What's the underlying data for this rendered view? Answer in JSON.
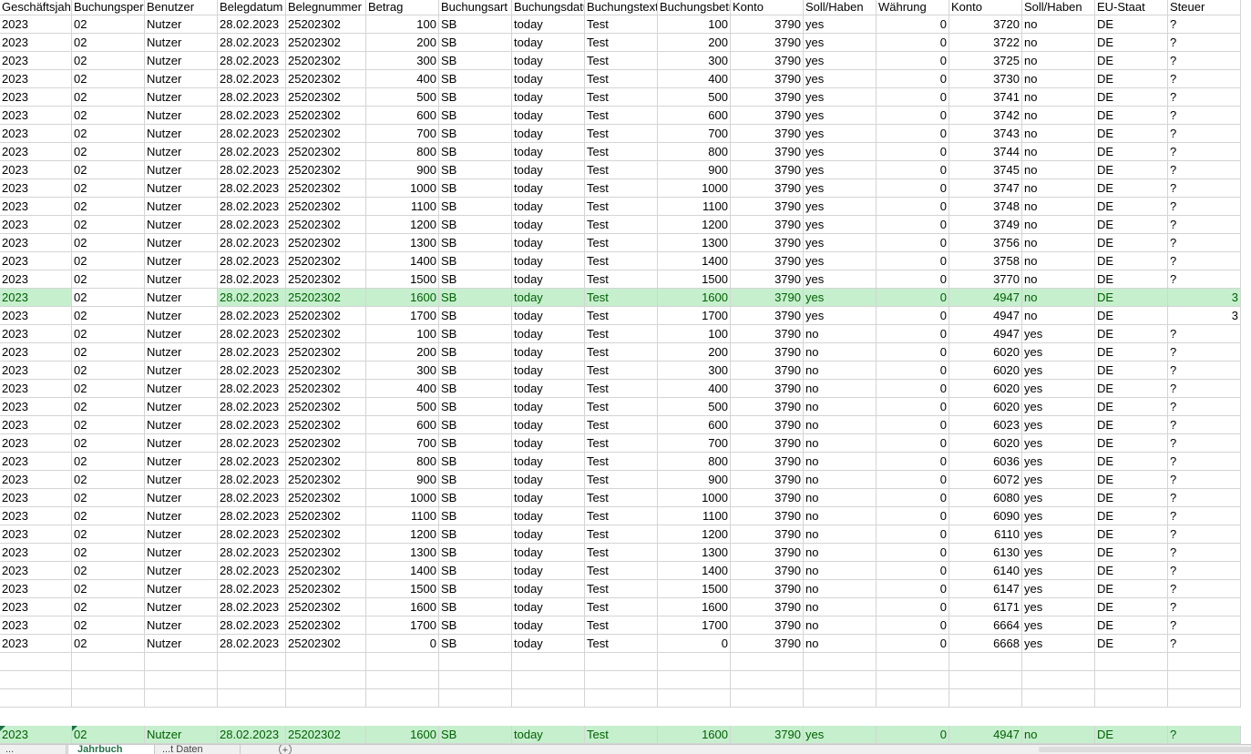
{
  "header": [
    "Geschäftsjahr",
    "Buchungsperiode",
    "Benutzer",
    "Belegdatum",
    "Belegnummer",
    "Betrag",
    "Buchungsart",
    "Buchungsdatum",
    "Buchungstext",
    "Buchungsbetrag",
    "Konto",
    "Soll/Haben",
    "Währung",
    "Konto",
    "Soll/Haben",
    "EU-Staat",
    "Steuer"
  ],
  "rows": [
    [
      "2023",
      "02",
      "Nutzer",
      "28.02.2023",
      "25202302",
      "100",
      "SB",
      "today",
      "Test",
      "100",
      "3790",
      "yes",
      "0",
      "3720",
      "no",
      "DE",
      "?"
    ],
    [
      "2023",
      "02",
      "Nutzer",
      "28.02.2023",
      "25202302",
      "200",
      "SB",
      "today",
      "Test",
      "200",
      "3790",
      "yes",
      "0",
      "3722",
      "no",
      "DE",
      "?"
    ],
    [
      "2023",
      "02",
      "Nutzer",
      "28.02.2023",
      "25202302",
      "300",
      "SB",
      "today",
      "Test",
      "300",
      "3790",
      "yes",
      "0",
      "3725",
      "no",
      "DE",
      "?"
    ],
    [
      "2023",
      "02",
      "Nutzer",
      "28.02.2023",
      "25202302",
      "400",
      "SB",
      "today",
      "Test",
      "400",
      "3790",
      "yes",
      "0",
      "3730",
      "no",
      "DE",
      "?"
    ],
    [
      "2023",
      "02",
      "Nutzer",
      "28.02.2023",
      "25202302",
      "500",
      "SB",
      "today",
      "Test",
      "500",
      "3790",
      "yes",
      "0",
      "3741",
      "no",
      "DE",
      "?"
    ],
    [
      "2023",
      "02",
      "Nutzer",
      "28.02.2023",
      "25202302",
      "600",
      "SB",
      "today",
      "Test",
      "600",
      "3790",
      "yes",
      "0",
      "3742",
      "no",
      "DE",
      "?"
    ],
    [
      "2023",
      "02",
      "Nutzer",
      "28.02.2023",
      "25202302",
      "700",
      "SB",
      "today",
      "Test",
      "700",
      "3790",
      "yes",
      "0",
      "3743",
      "no",
      "DE",
      "?"
    ],
    [
      "2023",
      "02",
      "Nutzer",
      "28.02.2023",
      "25202302",
      "800",
      "SB",
      "today",
      "Test",
      "800",
      "3790",
      "yes",
      "0",
      "3744",
      "no",
      "DE",
      "?"
    ],
    [
      "2023",
      "02",
      "Nutzer",
      "28.02.2023",
      "25202302",
      "900",
      "SB",
      "today",
      "Test",
      "900",
      "3790",
      "yes",
      "0",
      "3745",
      "no",
      "DE",
      "?"
    ],
    [
      "2023",
      "02",
      "Nutzer",
      "28.02.2023",
      "25202302",
      "1000",
      "SB",
      "today",
      "Test",
      "1000",
      "3790",
      "yes",
      "0",
      "3747",
      "no",
      "DE",
      "?"
    ],
    [
      "2023",
      "02",
      "Nutzer",
      "28.02.2023",
      "25202302",
      "1100",
      "SB",
      "today",
      "Test",
      "1100",
      "3790",
      "yes",
      "0",
      "3748",
      "no",
      "DE",
      "?"
    ],
    [
      "2023",
      "02",
      "Nutzer",
      "28.02.2023",
      "25202302",
      "1200",
      "SB",
      "today",
      "Test",
      "1200",
      "3790",
      "yes",
      "0",
      "3749",
      "no",
      "DE",
      "?"
    ],
    [
      "2023",
      "02",
      "Nutzer",
      "28.02.2023",
      "25202302",
      "1300",
      "SB",
      "today",
      "Test",
      "1300",
      "3790",
      "yes",
      "0",
      "3756",
      "no",
      "DE",
      "?"
    ],
    [
      "2023",
      "02",
      "Nutzer",
      "28.02.2023",
      "25202302",
      "1400",
      "SB",
      "today",
      "Test",
      "1400",
      "3790",
      "yes",
      "0",
      "3758",
      "no",
      "DE",
      "?"
    ],
    [
      "2023",
      "02",
      "Nutzer",
      "28.02.2023",
      "25202302",
      "1500",
      "SB",
      "today",
      "Test",
      "1500",
      "3790",
      "yes",
      "0",
      "3770",
      "no",
      "DE",
      "?"
    ],
    [
      "2023",
      "02",
      "Nutzer",
      "28.02.2023",
      "25202302",
      "1600",
      "SB",
      "today",
      "Test",
      "1600",
      "3790",
      "yes",
      "0",
      "4947",
      "no",
      "DE",
      "3"
    ],
    [
      "2023",
      "02",
      "Nutzer",
      "28.02.2023",
      "25202302",
      "1700",
      "SB",
      "today",
      "Test",
      "1700",
      "3790",
      "yes",
      "0",
      "4947",
      "no",
      "DE",
      "3"
    ],
    [
      "2023",
      "02",
      "Nutzer",
      "28.02.2023",
      "25202302",
      "100",
      "SB",
      "today",
      "Test",
      "100",
      "3790",
      "no",
      "0",
      "4947",
      "yes",
      "DE",
      "?"
    ],
    [
      "2023",
      "02",
      "Nutzer",
      "28.02.2023",
      "25202302",
      "200",
      "SB",
      "today",
      "Test",
      "200",
      "3790",
      "no",
      "0",
      "6020",
      "yes",
      "DE",
      "?"
    ],
    [
      "2023",
      "02",
      "Nutzer",
      "28.02.2023",
      "25202302",
      "300",
      "SB",
      "today",
      "Test",
      "300",
      "3790",
      "no",
      "0",
      "6020",
      "yes",
      "DE",
      "?"
    ],
    [
      "2023",
      "02",
      "Nutzer",
      "28.02.2023",
      "25202302",
      "400",
      "SB",
      "today",
      "Test",
      "400",
      "3790",
      "no",
      "0",
      "6020",
      "yes",
      "DE",
      "?"
    ],
    [
      "2023",
      "02",
      "Nutzer",
      "28.02.2023",
      "25202302",
      "500",
      "SB",
      "today",
      "Test",
      "500",
      "3790",
      "no",
      "0",
      "6020",
      "yes",
      "DE",
      "?"
    ],
    [
      "2023",
      "02",
      "Nutzer",
      "28.02.2023",
      "25202302",
      "600",
      "SB",
      "today",
      "Test",
      "600",
      "3790",
      "no",
      "0",
      "6023",
      "yes",
      "DE",
      "?"
    ],
    [
      "2023",
      "02",
      "Nutzer",
      "28.02.2023",
      "25202302",
      "700",
      "SB",
      "today",
      "Test",
      "700",
      "3790",
      "no",
      "0",
      "6020",
      "yes",
      "DE",
      "?"
    ],
    [
      "2023",
      "02",
      "Nutzer",
      "28.02.2023",
      "25202302",
      "800",
      "SB",
      "today",
      "Test",
      "800",
      "3790",
      "no",
      "0",
      "6036",
      "yes",
      "DE",
      "?"
    ],
    [
      "2023",
      "02",
      "Nutzer",
      "28.02.2023",
      "25202302",
      "900",
      "SB",
      "today",
      "Test",
      "900",
      "3790",
      "no",
      "0",
      "6072",
      "yes",
      "DE",
      "?"
    ],
    [
      "2023",
      "02",
      "Nutzer",
      "28.02.2023",
      "25202302",
      "1000",
      "SB",
      "today",
      "Test",
      "1000",
      "3790",
      "no",
      "0",
      "6080",
      "yes",
      "DE",
      "?"
    ],
    [
      "2023",
      "02",
      "Nutzer",
      "28.02.2023",
      "25202302",
      "1100",
      "SB",
      "today",
      "Test",
      "1100",
      "3790",
      "no",
      "0",
      "6090",
      "yes",
      "DE",
      "?"
    ],
    [
      "2023",
      "02",
      "Nutzer",
      "28.02.2023",
      "25202302",
      "1200",
      "SB",
      "today",
      "Test",
      "1200",
      "3790",
      "no",
      "0",
      "6110",
      "yes",
      "DE",
      "?"
    ],
    [
      "2023",
      "02",
      "Nutzer",
      "28.02.2023",
      "25202302",
      "1300",
      "SB",
      "today",
      "Test",
      "1300",
      "3790",
      "no",
      "0",
      "6130",
      "yes",
      "DE",
      "?"
    ],
    [
      "2023",
      "02",
      "Nutzer",
      "28.02.2023",
      "25202302",
      "1400",
      "SB",
      "today",
      "Test",
      "1400",
      "3790",
      "no",
      "0",
      "6140",
      "yes",
      "DE",
      "?"
    ],
    [
      "2023",
      "02",
      "Nutzer",
      "28.02.2023",
      "25202302",
      "1500",
      "SB",
      "today",
      "Test",
      "1500",
      "3790",
      "no",
      "0",
      "6147",
      "yes",
      "DE",
      "?"
    ],
    [
      "2023",
      "02",
      "Nutzer",
      "28.02.2023",
      "25202302",
      "1600",
      "SB",
      "today",
      "Test",
      "1600",
      "3790",
      "no",
      "0",
      "6171",
      "yes",
      "DE",
      "?"
    ],
    [
      "2023",
      "02",
      "Nutzer",
      "28.02.2023",
      "25202302",
      "1700",
      "SB",
      "today",
      "Test",
      "1700",
      "3790",
      "no",
      "0",
      "6664",
      "yes",
      "DE",
      "?"
    ],
    [
      "2023",
      "02",
      "Nutzer",
      "28.02.2023",
      "25202302",
      "0",
      "SB",
      "today",
      "Test",
      "0",
      "3790",
      "no",
      "0",
      "6668",
      "yes",
      "DE",
      "?"
    ]
  ],
  "highlighted_row": [
    "2023",
    "02",
    "Nutzer",
    "28.02.2023",
    "25202302",
    "1600",
    "SB",
    "today",
    "Test",
    "1600",
    "3790",
    "yes",
    "0",
    "4947",
    "no",
    "DE",
    "3"
  ],
  "footer_row": [
    "2023",
    "02",
    "Nutzer",
    "28.02.2023",
    "25202302",
    "1600",
    "SB",
    "today",
    "Test",
    "1600",
    "3790",
    "yes",
    "0",
    "4947",
    "no",
    "DE",
    "?"
  ],
  "sheet_tabs": [
    "...",
    "Jahrbuch",
    "...t Daten"
  ],
  "add_sheet_symbol": "+",
  "colors": {
    "highlight_fill": "#c6efce",
    "highlight_text": "#006100",
    "gridline": "#d4d4d4",
    "excel_green": "#217346"
  }
}
